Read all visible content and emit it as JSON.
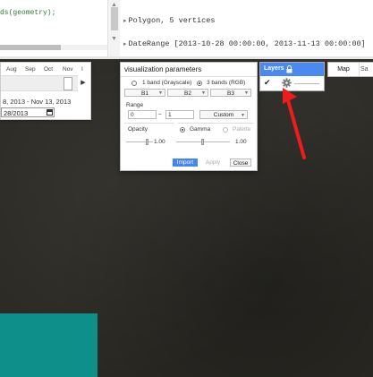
{
  "code_editor": {
    "line": "ds(geometry);"
  },
  "console": {
    "lines": [
      {
        "text": "Polygon, 5 vertices"
      },
      {
        "text": "DateRange [2013-10-28 00:00:00, 2013-11-13 00:00:00]"
      }
    ]
  },
  "date_panel": {
    "months": [
      "Aug",
      "Sep",
      "Oct",
      "Nov",
      "I"
    ],
    "range_text": "8, 2013 - Nov 13, 2013",
    "date_value": "28/2013"
  },
  "vis_params": {
    "title": "visualization parameters",
    "band_options": [
      "1 band (Grayscale)",
      "3 bands (RGB)"
    ],
    "bands": [
      "B1",
      "B2",
      "B3"
    ],
    "range_label": "Range",
    "range_min": "0",
    "range_max": "1",
    "range_mode": "Custom",
    "opacity_label": "Opacity",
    "opacity_value": "1.00",
    "gamma_label": "Gamma",
    "palette_label": "Palette",
    "gamma_value": "1.00",
    "buttons": {
      "import": "Import",
      "apply": "Apply",
      "close": "Close"
    }
  },
  "layers": {
    "title": "Layers"
  },
  "map_toggle": {
    "map": "Map",
    "satellite": "Sa"
  },
  "colors": {
    "accent": "#4a89f0",
    "import_button": "#4285f4",
    "map_background": "#2a2924",
    "teal_overlay": "#0f8f8a",
    "annotation_arrow": "#ee1c1c"
  },
  "icons": [
    "lock-icon",
    "check-icon",
    "gear-icon",
    "calendar-icon",
    "play-icon"
  ]
}
